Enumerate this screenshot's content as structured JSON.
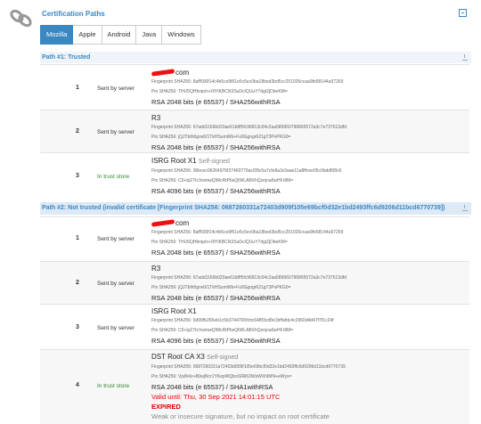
{
  "header": {
    "title": "Certification Paths"
  },
  "tabs": [
    "Mozilla",
    "Apple",
    "Android",
    "Java",
    "Windows"
  ],
  "paths": [
    {
      "title": "Path #1: Trusted",
      "rows": [
        {
          "num": "1",
          "status": "Sent by server",
          "name_suffix": "com",
          "fingerprint": "Fingerprint SHA256: 8aff500f14c4b5ce9f61e5c5ec0ba18bed3bd5cc251926ccaa9fe58144a97269",
          "pin": "Pin SHA256: THU5QHbnip/n+0lYIKBCN3SuDcIQUuY7dgiZjDbeKM=",
          "key": "RSA 2048 bits (e 65537) / SHA256withRSA"
        },
        {
          "num": "2",
          "status": "Sent by server",
          "name": "R3",
          "fingerprint": "Fingerprint SHA256: 67add1166b020ae61b8f5fc96813c04c2aa589960796865572a3c7e737613dfd",
          "pin": "Pin SHA256: jQJTbIh0grw0/1TkHSumWb+Fs0Ggogr621gT3PvPKG0=",
          "key": "RSA 2048 bits (e 65537) / SHA256withRSA"
        },
        {
          "num": "3",
          "status": "In trust store",
          "name": "ISRG Root X1",
          "self": "Self-signed",
          "fingerprint": "Fingerprint SHA256: 96bcec06264976f37460779acf28c5a7cfe8a3c0aae11a8ffcee05c0bddf08c6",
          "pin": "Pin SHA256: C5+lpZ7tcVwmwQIMcRtPbsQtWLABXhQzejna0wHFr8M=",
          "key": "RSA 4096 bits (e 65537) / SHA256withRSA"
        }
      ]
    },
    {
      "title": "Path #2: Not trusted (invalid certificate [Fingerprint SHA256: 0687260331a72403d909f105e69bcf0d32e1bd2493ffc6d9206d11bcd6770739])",
      "rows": [
        {
          "num": "1",
          "status": "Sent by server",
          "name_suffix": "com",
          "fingerprint": "Fingerprint SHA256: 8aff500f14c4b5ce9f61e5c5ec0ba18bed3bd5cc251926ccaa9fe58144a97269",
          "pin": "Pin SHA256: THU5QHbnip/n+0lYIKBCN3SuDcIQUuY7dgiZjDbeKM=",
          "key": "RSA 2048 bits (e 65537) / SHA256withRSA"
        },
        {
          "num": "2",
          "status": "Sent by server",
          "name": "R3",
          "fingerprint": "Fingerprint SHA256: 67add1166b020ae61b8f5fc96813c04c2aa589960796865572a3c7e737613dfd",
          "pin": "Pin SHA256: jQJTbIh0grw0/1TkHSumWb+Fs0Ggogr621gT3PvPKG0=",
          "key": "RSA 2048 bits (e 65537) / SHA256withRSA"
        },
        {
          "num": "3",
          "status": "Sent by server",
          "name": "ISRG Root X1",
          "fingerprint": "Fingerprint SHA256: 6d99fb265eb1c5b3744765fcbc648f3cd8e1bffafdc4c2960d4d47f7f1c24f",
          "pin": "Pin SHA256: C5+lpZ7tcVwmwQIMcRtPbsQtWLABXhQzejna0wHFr8M=",
          "key": "RSA 4096 bits (e 65537) / SHA256withRSA"
        },
        {
          "num": "4",
          "status": "In trust store",
          "name": "DST Root CA X3",
          "self": "Self-signed",
          "fingerprint": "Fingerprint SHA256: 0687260331a72403d909f105e69bcf0d32e1bd2493ffc6d9206d11bcd6770739",
          "pin": "Pin SHA256: Vjs8r4z+80wjNcr1YKepWQboSIRi63WsWXhIMN+eWys=",
          "key": "RSA 2048 bits (e 65537) / SHA1withRSA",
          "valid": "Valid until: Thu, 30 Sep 2021 14:01:15 UTC",
          "expired": "EXPIRED",
          "warning": "Weak or insecure signature, but no impact on root certificate"
        }
      ]
    }
  ]
}
